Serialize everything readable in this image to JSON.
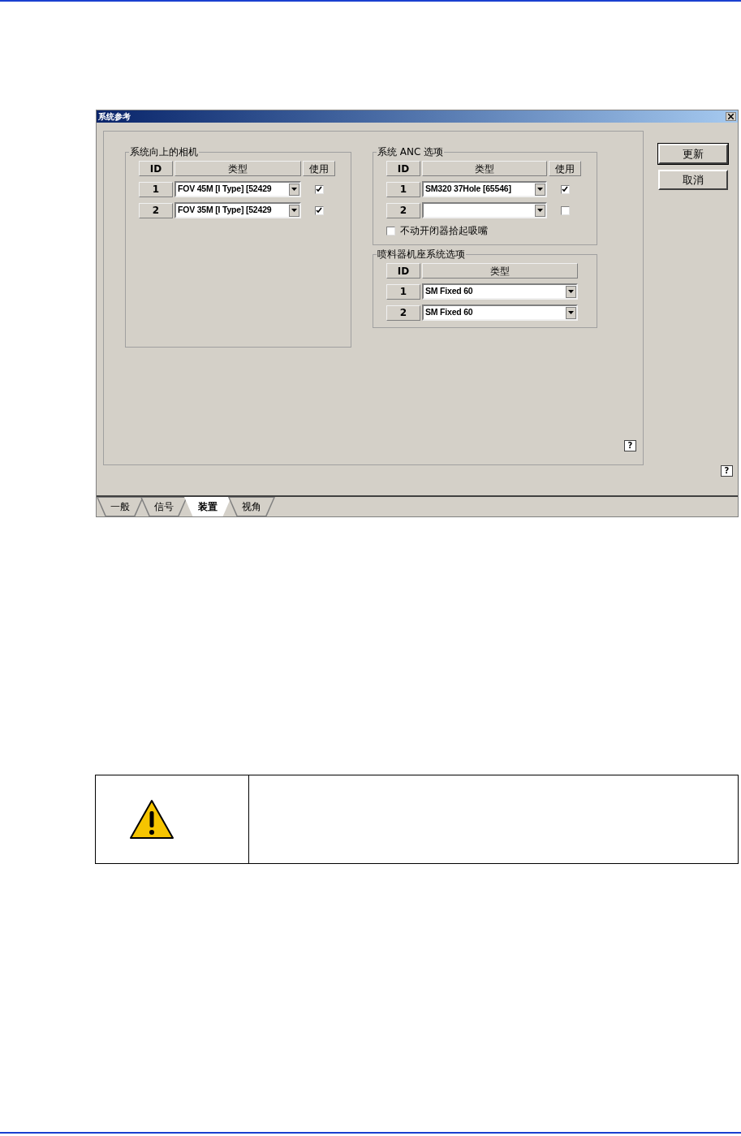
{
  "dialog": {
    "title": "系统参考",
    "buttons": [
      "更新",
      "取消"
    ],
    "camera_group": {
      "title": "系统向上的相机",
      "columns": [
        "ID",
        "类型",
        "使用"
      ],
      "rows": [
        {
          "id": "1",
          "type": "FOV 45M [I Type] [52429",
          "checked": true
        },
        {
          "id": "2",
          "type": "FOV 35M [I Type] [52429",
          "checked": true
        }
      ]
    },
    "anc_group": {
      "title": "系统 ANC 选项",
      "columns": [
        "ID",
        "类型",
        "使用"
      ],
      "rows": [
        {
          "id": "1",
          "type": "SM320 37Hole [65546]",
          "checked": true
        },
        {
          "id": "2",
          "checked": false
        }
      ],
      "option": {
        "label": "不动开闭器拾起吸嘴",
        "checked": false
      }
    },
    "feeder_group": {
      "title": "喷料器机座系统选项",
      "columns": [
        "ID",
        "类型"
      ],
      "rows": [
        {
          "id": "1",
          "type": "SM Fixed 60"
        },
        {
          "id": "2",
          "type": "SM Fixed 60"
        }
      ]
    },
    "help_buttons": [
      "?",
      "?"
    ],
    "tabs": [
      {
        "label": "一般",
        "selected": false
      },
      {
        "label": "信号",
        "selected": false
      },
      {
        "label": "装置",
        "selected": true
      },
      {
        "label": "视角",
        "selected": false
      }
    ]
  }
}
